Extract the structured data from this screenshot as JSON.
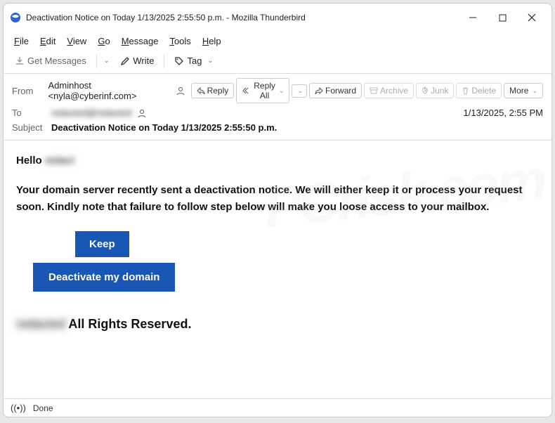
{
  "window": {
    "title": "Deactivation Notice on Today 1/13/2025 2:55:50 p.m. - Mozilla Thunderbird"
  },
  "menu": {
    "file": "File",
    "edit": "Edit",
    "view": "View",
    "go": "Go",
    "message": "Message",
    "tools": "Tools",
    "help": "Help"
  },
  "toolbar": {
    "get_messages": "Get Messages",
    "write": "Write",
    "tag": "Tag"
  },
  "header": {
    "from_label": "From",
    "from_value": "Adminhost <nyla@cyberinf.com>",
    "to_label": "To",
    "to_value": "redacted@redacted",
    "subject_label": "Subject",
    "subject_value": "Deactivation Notice on Today 1/13/2025 2:55:50 p.m.",
    "date": "1/13/2025, 2:55 PM",
    "actions": {
      "reply": "Reply",
      "reply_all": "Reply All",
      "forward": "Forward",
      "archive": "Archive",
      "junk": "Junk",
      "delete": "Delete",
      "more": "More"
    }
  },
  "email": {
    "greeting_prefix": "Hello ",
    "greeting_name": "redact",
    "paragraph": "Your domain server recently sent a deactivation notice.  We will either keep it or process your request soon.  Kindly note that failure to follow step below will make you loose access to your mailbox.",
    "keep_button": "Keep",
    "deactivate_button": "Deactivate my domain",
    "footer_redacted": "redacted",
    "footer_text": " All Rights Reserved."
  },
  "status": {
    "text": "Done"
  }
}
